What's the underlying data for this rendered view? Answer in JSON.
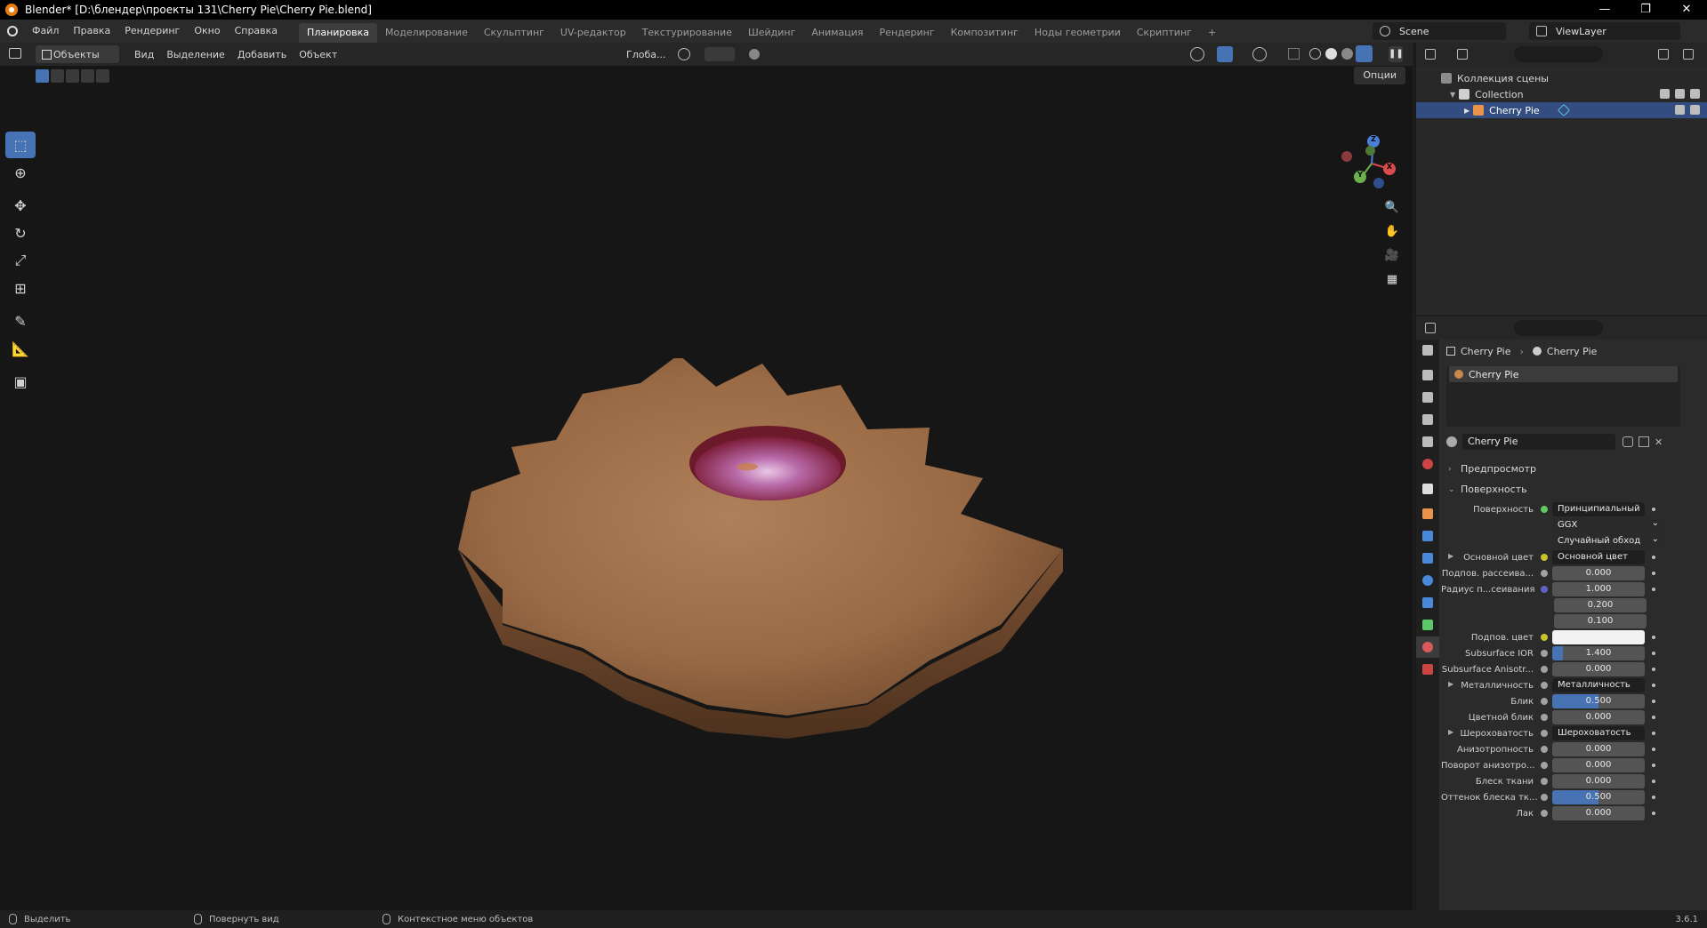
{
  "window": {
    "title": "Blender* [D:\\блендер\\проекты 131\\Cherry Pie\\Cherry Pie.blend]",
    "controls": [
      "—",
      "❐",
      "✕"
    ]
  },
  "menu": {
    "items": [
      "Файл",
      "Правка",
      "Рендеринг",
      "Окно",
      "Справка"
    ],
    "workspaces": [
      "Планировка",
      "Моделирование",
      "Скульптинг",
      "UV-редактор",
      "Текстурирование",
      "Шейдинг",
      "Анимация",
      "Рендеринг",
      "Композитинг",
      "Ноды геометрии",
      "Скриптинг"
    ],
    "active_workspace": 0,
    "add_tab": "+",
    "scene": "Scene",
    "view_layer": "ViewLayer"
  },
  "viewport": {
    "mode": "Объекты",
    "menus": [
      "Вид",
      "Выделение",
      "Добавить",
      "Объект"
    ],
    "transform_orientation": "Глоба...",
    "options": "Опции",
    "gizmo_axes": {
      "x": "X",
      "y": "Y",
      "z": "Z"
    }
  },
  "outliner": {
    "rows": [
      {
        "label": "Коллекция сцены",
        "depth": 0,
        "icon_color": "#8c8c8c",
        "selected": false
      },
      {
        "label": "Collection",
        "depth": 1,
        "icon_color": "#d0d0d0",
        "selected": false
      },
      {
        "label": "Cherry Pie",
        "depth": 2,
        "icon_color": "#e8944a",
        "selected": true
      }
    ]
  },
  "properties": {
    "breadcrumb": [
      "Cherry Pie",
      "Cherry Pie"
    ],
    "slot": "Cherry Pie",
    "material_name": "Cherry Pie",
    "preview_label": "Предпросмотр",
    "surface_label": "Поверхность",
    "rows": [
      {
        "label": "Поверхность",
        "value": "Принципиальный BSDF",
        "sock": "#63c763",
        "kind": "dark"
      },
      {
        "label": "",
        "value": "GGX",
        "sock": "",
        "kind": "dropdown"
      },
      {
        "label": "",
        "value": "Случайный обход",
        "sock": "",
        "kind": "dropdown"
      },
      {
        "label": "Основной цвет",
        "value": "Основной цвет",
        "sock": "#c7c729",
        "kind": "dark",
        "expander": true
      },
      {
        "label": "Подпов. рассеива...",
        "value": "0.000",
        "sock": "#a1a1a1",
        "kind": "num",
        "fill": 0
      },
      {
        "label": "Радиус п...сеивания",
        "value": "1.000",
        "sock": "#6363c7",
        "kind": "num",
        "fill": 0
      },
      {
        "label": "",
        "value": "0.200",
        "sock": "",
        "kind": "num-sub",
        "fill": 0
      },
      {
        "label": "",
        "value": "0.100",
        "sock": "",
        "kind": "num-sub",
        "fill": 0
      },
      {
        "label": "Подпов. цвет",
        "value": "",
        "sock": "#c7c729",
        "kind": "color"
      },
      {
        "label": "Subsurface IOR",
        "value": "1.400",
        "sock": "#a1a1a1",
        "kind": "num",
        "fill": 0.12
      },
      {
        "label": "Subsurface Anisotr...",
        "value": "0.000",
        "sock": "#a1a1a1",
        "kind": "num",
        "fill": 0
      },
      {
        "label": "Металличность",
        "value": "Металличность",
        "sock": "#a1a1a1",
        "kind": "dark",
        "expander": true
      },
      {
        "label": "Блик",
        "value": "0.500",
        "sock": "#a1a1a1",
        "kind": "num",
        "fill": 0.5
      },
      {
        "label": "Цветной блик",
        "value": "0.000",
        "sock": "#a1a1a1",
        "kind": "num",
        "fill": 0
      },
      {
        "label": "Шероховатость",
        "value": "Шероховатость",
        "sock": "#a1a1a1",
        "kind": "dark",
        "expander": true
      },
      {
        "label": "Анизотропность",
        "value": "0.000",
        "sock": "#a1a1a1",
        "kind": "num",
        "fill": 0
      },
      {
        "label": "Поворот анизотро...",
        "value": "0.000",
        "sock": "#a1a1a1",
        "kind": "num",
        "fill": 0
      },
      {
        "label": "Блеск ткани",
        "value": "0.000",
        "sock": "#a1a1a1",
        "kind": "num",
        "fill": 0
      },
      {
        "label": "Оттенок блеска тк...",
        "value": "0.500",
        "sock": "#a1a1a1",
        "kind": "num",
        "fill": 0.5
      },
      {
        "label": "Лак",
        "value": "0.000",
        "sock": "#a1a1a1",
        "kind": "num",
        "fill": 0
      }
    ]
  },
  "status": {
    "items": [
      "Выделить",
      "Повернуть вид",
      "Контекстное меню объектов"
    ],
    "version": "3.6.1"
  },
  "colors": {
    "accent": "#4772b3",
    "selected_row": "#334d80",
    "pie_crust": "#9a6a45",
    "filling": "#b05a8a"
  }
}
